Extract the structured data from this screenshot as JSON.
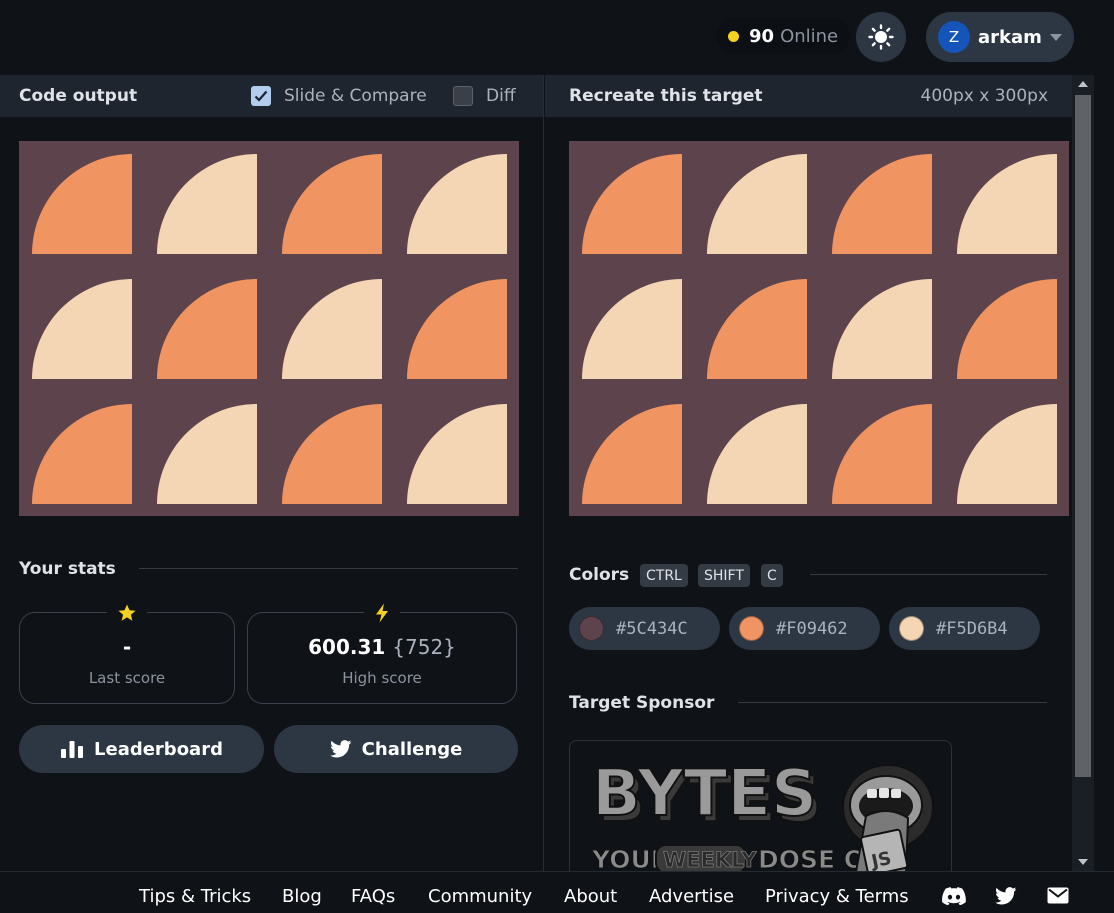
{
  "header": {
    "online_count": "90",
    "online_label": "Online",
    "user": {
      "initial": "Z",
      "name": "arkam"
    }
  },
  "code_output": {
    "title": "Code output",
    "slide_compare_label": "Slide & Compare",
    "slide_compare_checked": true,
    "diff_label": "Diff",
    "diff_checked": false
  },
  "target": {
    "title": "Recreate this target",
    "dimensions": "400px x 300px"
  },
  "board": {
    "background": "#5C434C",
    "rows": [
      [
        "#F09462",
        "#F5D6B4",
        "#F09462",
        "#F5D6B4"
      ],
      [
        "#F5D6B4",
        "#F09462",
        "#F5D6B4",
        "#F09462"
      ],
      [
        "#F09462",
        "#F5D6B4",
        "#F09462",
        "#F5D6B4"
      ]
    ]
  },
  "stats": {
    "title": "Your stats",
    "last_score": {
      "icon": "star-icon",
      "value": "-",
      "label": "Last score"
    },
    "high_score": {
      "icon": "lightning-icon",
      "value": "600.31",
      "sub": "{752}",
      "label": "High score"
    }
  },
  "buttons": {
    "leaderboard": "Leaderboard",
    "challenge": "Challenge"
  },
  "colors": {
    "title": "Colors",
    "shortcut": [
      "CTRL",
      "SHIFT",
      "C"
    ],
    "swatches": [
      {
        "hex": "#5C434C"
      },
      {
        "hex": "#F09462"
      },
      {
        "hex": "#F5D6B4"
      }
    ]
  },
  "sponsor": {
    "title": "Target Sponsor",
    "logo_text": "BYTES",
    "tagline_start": "YOUR",
    "tagline_mid": "WEEKLY",
    "tagline_end": "DOSE OF",
    "badge": "JS"
  },
  "footer": {
    "links": [
      "Tips & Tricks",
      "Blog",
      "FAQs",
      "Community",
      "About",
      "Advertise",
      "Privacy & Terms"
    ]
  }
}
